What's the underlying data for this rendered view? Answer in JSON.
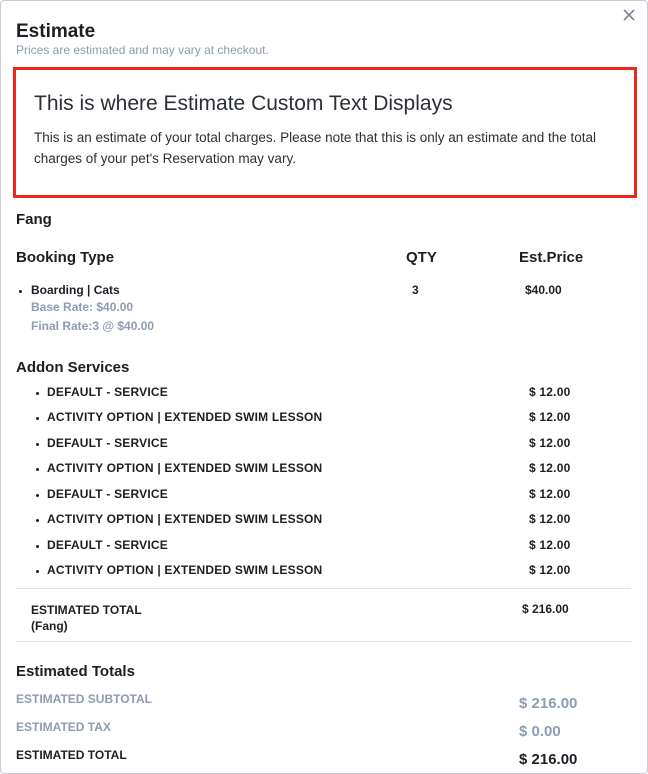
{
  "modal": {
    "title": "Estimate",
    "subtitle": "Prices are estimated and may vary at checkout."
  },
  "custom_text": {
    "title": "This is where Estimate Custom Text Displays",
    "body": "This is an estimate of your total charges. Please note that this is only an estimate and the total charges of your pet's Reservation may vary."
  },
  "pet": {
    "name": "Fang",
    "headers": {
      "booking_type": "Booking Type",
      "qty": "QTY",
      "price": "Est.Price"
    },
    "booking": {
      "name": "Boarding | Cats",
      "qty": "3",
      "price": "$40.00",
      "base_rate": "Base Rate: $40.00",
      "final_rate": "Final Rate:3 @ $40.00"
    },
    "addon_header": "Addon Services",
    "addons": [
      {
        "name": "DEFAULT - SERVICE",
        "price": "$ 12.00"
      },
      {
        "name": "ACTIVITY OPTION | EXTENDED SWIM LESSON",
        "price": "$ 12.00"
      },
      {
        "name": "DEFAULT - SERVICE",
        "price": "$ 12.00"
      },
      {
        "name": "ACTIVITY OPTION | EXTENDED SWIM LESSON",
        "price": "$ 12.00"
      },
      {
        "name": "DEFAULT - SERVICE",
        "price": "$ 12.00"
      },
      {
        "name": "ACTIVITY OPTION | EXTENDED SWIM LESSON",
        "price": "$ 12.00"
      },
      {
        "name": "DEFAULT - SERVICE",
        "price": "$ 12.00"
      },
      {
        "name": "ACTIVITY OPTION | EXTENDED SWIM LESSON",
        "price": "$ 12.00"
      }
    ],
    "estimated_total_label": "ESTIMATED TOTAL",
    "estimated_total_pet": "(Fang)",
    "estimated_total_value": "$ 216.00"
  },
  "totals": {
    "header": "Estimated Totals",
    "subtotal_label": "ESTIMATED SUBTOTAL",
    "subtotal_value": "$ 216.00",
    "tax_label": "ESTIMATED TAX",
    "tax_value": "$ 0.00",
    "total_label": "ESTIMATED TOTAL",
    "total_value": "$ 216.00"
  },
  "colors": {
    "highlight_border": "#e8291c",
    "muted_text": "#8d9bb3"
  }
}
